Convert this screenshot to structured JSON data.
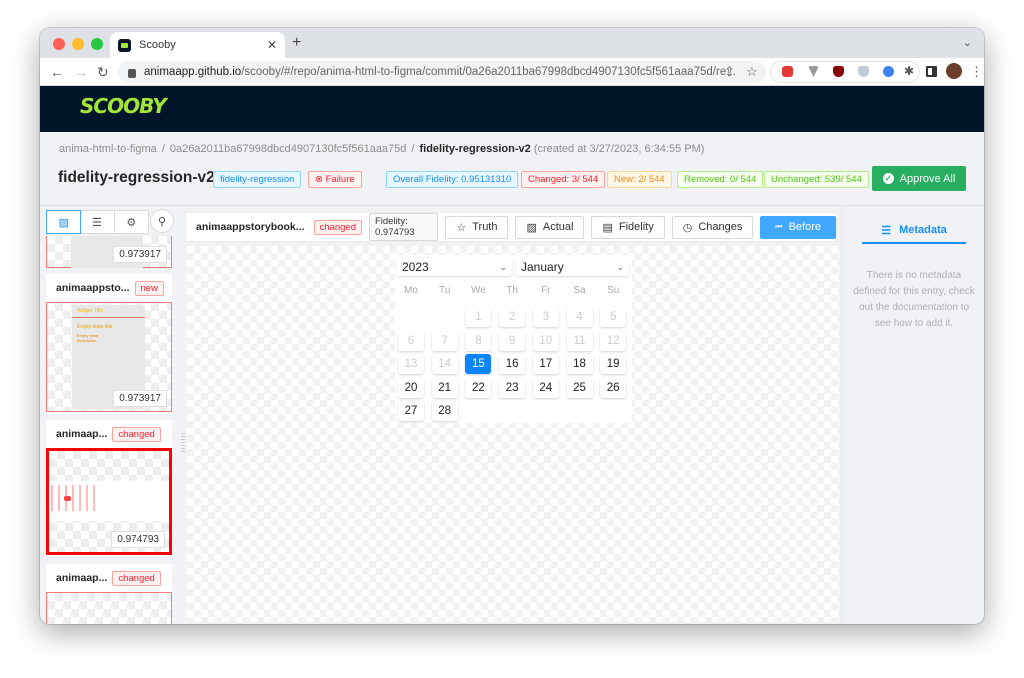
{
  "browser": {
    "tab_title": "Scooby",
    "url_host": "animaapp.github.io",
    "url_path": "/scooby/#/repo/anima-html-to-figma/commit/0a26a2011ba67998dbcd4907130fc5f561aaa75d/re..."
  },
  "app": {
    "logo": "SCOOBY"
  },
  "breadcrumb": {
    "repo": "anima-html-to-figma",
    "commit": "0a26a2011ba67998dbcd4907130fc5f561aaa75d",
    "current": "fidelity-regression-v2",
    "created": "(created at 3/27/2023, 6:34:55 PM)"
  },
  "header": {
    "title": "fidelity-regression-v2",
    "type_tag": "fidelity-regression",
    "status_tag": "Failure",
    "overall": "Overall Fidelity: 0.95131310",
    "changed": "Changed: 3/ 544",
    "new": "New: 2/ 544",
    "removed": "Removed: 0/ 544",
    "unchanged": "Unchanged: 539/ 544",
    "approve_all": "Approve All"
  },
  "sidebar": {
    "cards": [
      {
        "name": "",
        "badge": "",
        "score": "0.973917"
      },
      {
        "name": "animaappsto...",
        "badge": "new",
        "score": "0.973917",
        "preview_title": "Widget Title",
        "preview_heading": "Empty state title",
        "preview_desc": "Empty state description"
      },
      {
        "name": "animaap...",
        "badge": "changed",
        "score": "0.974793"
      },
      {
        "name": "animaap...",
        "badge": "changed",
        "score": ""
      }
    ]
  },
  "toolbar": {
    "name": "animaappstorybook...",
    "badge": "changed",
    "fidelity": "Fidelity: 0.974793",
    "truth": "Truth",
    "actual": "Actual",
    "fidelity_btn": "Fidelity",
    "changes": "Changes",
    "before": "Before"
  },
  "calendar": {
    "year": "2023",
    "month": "January",
    "weekdays": [
      "Mo",
      "Tu",
      "We",
      "Th",
      "Fr",
      "Sa",
      "Su"
    ],
    "days": [
      {
        "n": "1",
        "col": 2,
        "row": 0,
        "state": "dis"
      },
      {
        "n": "2",
        "col": 3,
        "row": 0,
        "state": "dis"
      },
      {
        "n": "3",
        "col": 4,
        "row": 0,
        "state": "dis"
      },
      {
        "n": "4",
        "col": 5,
        "row": 0,
        "state": "dis"
      },
      {
        "n": "5",
        "col": 6,
        "row": 0,
        "state": "dis"
      },
      {
        "n": "6",
        "col": 0,
        "row": 1,
        "state": "dis"
      },
      {
        "n": "7",
        "col": 1,
        "row": 1,
        "state": "dis"
      },
      {
        "n": "8",
        "col": 2,
        "row": 1,
        "state": "dis"
      },
      {
        "n": "9",
        "col": 3,
        "row": 1,
        "state": "dis"
      },
      {
        "n": "10",
        "col": 4,
        "row": 1,
        "state": "dis"
      },
      {
        "n": "11",
        "col": 5,
        "row": 1,
        "state": "dis"
      },
      {
        "n": "12",
        "col": 6,
        "row": 1,
        "state": "dis"
      },
      {
        "n": "13",
        "col": 0,
        "row": 2,
        "state": "dis"
      },
      {
        "n": "14",
        "col": 1,
        "row": 2,
        "state": "dis"
      },
      {
        "n": "15",
        "col": 2,
        "row": 2,
        "state": "act"
      },
      {
        "n": "16",
        "col": 3,
        "row": 2,
        "state": ""
      },
      {
        "n": "17",
        "col": 4,
        "row": 2,
        "state": ""
      },
      {
        "n": "18",
        "col": 5,
        "row": 2,
        "state": ""
      },
      {
        "n": "19",
        "col": 6,
        "row": 2,
        "state": ""
      },
      {
        "n": "20",
        "col": 0,
        "row": 3,
        "state": ""
      },
      {
        "n": "21",
        "col": 1,
        "row": 3,
        "state": ""
      },
      {
        "n": "22",
        "col": 2,
        "row": 3,
        "state": ""
      },
      {
        "n": "23",
        "col": 3,
        "row": 3,
        "state": ""
      },
      {
        "n": "24",
        "col": 4,
        "row": 3,
        "state": ""
      },
      {
        "n": "25",
        "col": 5,
        "row": 3,
        "state": ""
      },
      {
        "n": "26",
        "col": 6,
        "row": 3,
        "state": ""
      },
      {
        "n": "27",
        "col": 0,
        "row": 4,
        "state": ""
      },
      {
        "n": "28",
        "col": 1,
        "row": 4,
        "state": ""
      }
    ]
  },
  "metadata": {
    "tab": "Metadata",
    "empty": "There is no metadata defined for this entry, check out the documentation to see how to add it."
  }
}
